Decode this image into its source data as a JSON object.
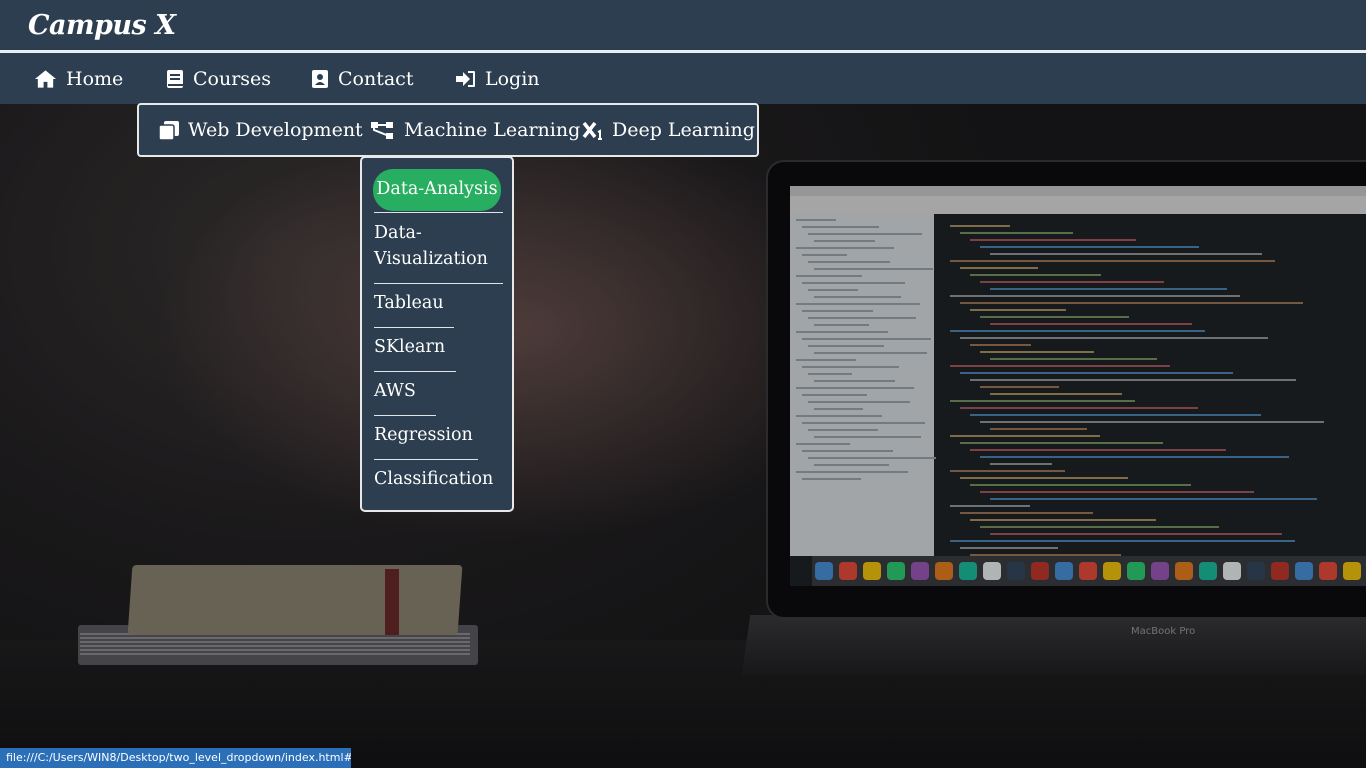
{
  "header": {
    "logo": "Campus X"
  },
  "nav": {
    "items": [
      {
        "label": "Home",
        "icon": "home-icon"
      },
      {
        "label": "Courses",
        "icon": "book-icon"
      },
      {
        "label": "Contact",
        "icon": "address-card-icon"
      },
      {
        "label": "Login",
        "icon": "sign-in-icon"
      }
    ]
  },
  "courses_menu": {
    "items": [
      {
        "label": "Web Development",
        "icon": "copy-icon"
      },
      {
        "label": "Machine Learning",
        "icon": "sitemap-icon"
      },
      {
        "label": "Deep Learning",
        "icon": "subscript-icon"
      }
    ]
  },
  "ml_submenu": {
    "items": [
      {
        "label": "Data-Analysis"
      },
      {
        "label": "Data-\nVisualization"
      },
      {
        "label": "Tableau"
      },
      {
        "label": "SKlearn"
      },
      {
        "label": "AWS"
      },
      {
        "label": "Regression"
      },
      {
        "label": "Classification"
      }
    ],
    "active_color": "#27ae60"
  },
  "status_bar": {
    "url": "file:///C:/Users/WIN8/Desktop/two_level_dropdown/index.html#"
  },
  "laptop": {
    "brand_label": "MacBook Pro"
  },
  "colors": {
    "nav_bg": "#2c3e50",
    "accent": "#27ae60",
    "status_bg": "#2a6fb8"
  }
}
